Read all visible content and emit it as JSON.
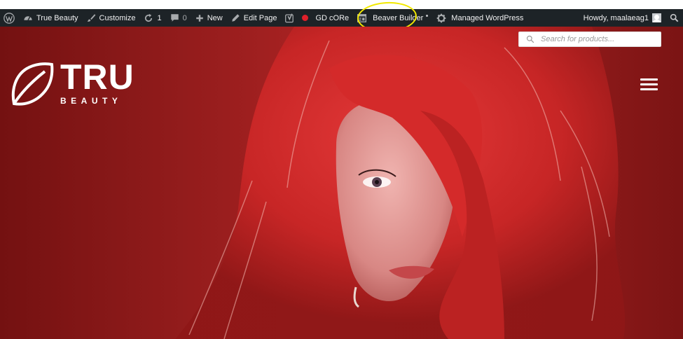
{
  "adminbar": {
    "site_name": "True Beauty",
    "customize": "Customize",
    "updates_count": "1",
    "comments_count": "0",
    "new_label": "New",
    "edit_page": "Edit Page",
    "gd_core": "GD cORe",
    "beaver_builder": "Beaver Builder",
    "managed_wp": "Managed WordPress",
    "howdy": "Howdy, maalaeag1"
  },
  "hero": {
    "search_placeholder": "Search for products...",
    "logo_main": "TRU",
    "logo_sub": "BEAUTY"
  },
  "colors": {
    "adminbar_bg": "#1d2327",
    "hero_red": "#a82222",
    "highlight": "#f2e900",
    "status_dot": "#e0202a"
  },
  "icons": [
    "wordpress-icon",
    "dashboard-icon",
    "brush-icon",
    "updates-icon",
    "comment-icon",
    "plus-icon",
    "pencil-icon",
    "yoast-icon",
    "status-dot-icon",
    "beaver-builder-icon",
    "gear-icon",
    "avatar",
    "search-icon",
    "menu-icon",
    "leaf-icon"
  ]
}
